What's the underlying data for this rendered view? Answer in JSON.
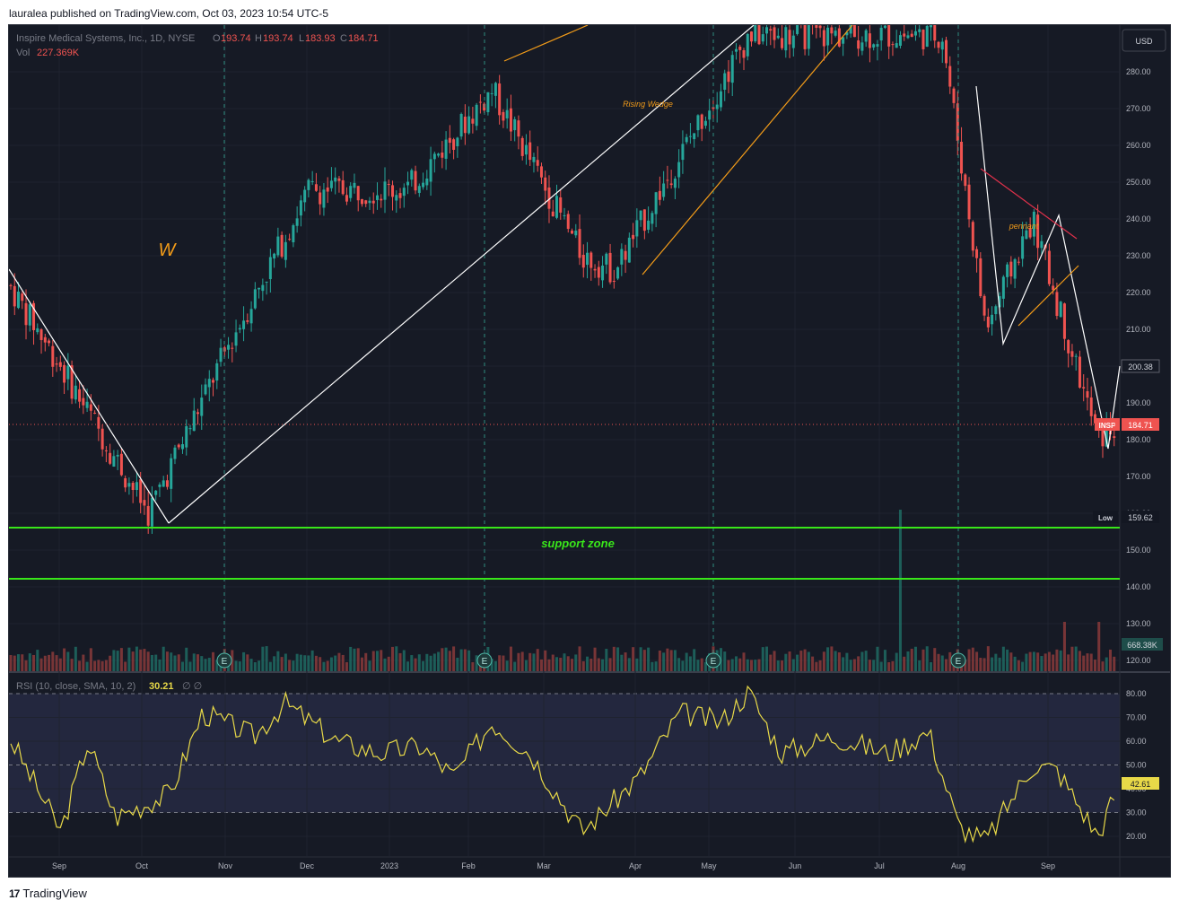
{
  "header": {
    "published": "lauralea published on TradingView.com, Oct 03, 2023 10:54 UTC-5"
  },
  "legend": {
    "symbol": "Inspire Medical Systems, Inc., 1D, NYSE",
    "o_label": "O",
    "o": "193.74",
    "h_label": "H",
    "h": "193.74",
    "l_label": "L",
    "l": "183.93",
    "c_label": "C",
    "c": "184.71",
    "vol_label": "Vol",
    "vol": "227.369K"
  },
  "currency": "USD",
  "rsi_legend": {
    "label": "RSI (10, close, SMA, 10, 2)",
    "value": "30.21",
    "extra": "∅ ∅"
  },
  "annotations": {
    "w": "W",
    "rising_wedge": "Rising Wedge",
    "pennant": "pennant",
    "support_zone": "support zone"
  },
  "price_badges": {
    "last_price": "200.38",
    "symbol_tag": "INSP",
    "close": "184.71",
    "low_label": "Low",
    "low_value": "159.62",
    "volume": "668.38K",
    "rsi_value": "42.61"
  },
  "footer": {
    "brand": "TradingView"
  },
  "colors": {
    "up": "#26a69a",
    "down": "#ef5350",
    "support": "#39e61a",
    "wedge": "#f39c19",
    "rsi_line": "#e8d948",
    "pennant_top": "#e0314b",
    "pattern_lines": "#ffffff"
  },
  "chart_data": {
    "type": "candlestick",
    "title": "Inspire Medical Systems, Inc., 1D, NYSE",
    "price_axis": {
      "ylim": [
        115,
        290
      ],
      "ticks": [
        120,
        130,
        140,
        150,
        160,
        170,
        180,
        190,
        200,
        210,
        220,
        230,
        240,
        250,
        260,
        270,
        280
      ]
    },
    "time_axis_labels": [
      "Sep",
      "Oct",
      "Nov",
      "Dec",
      "2023",
      "Feb",
      "Mar",
      "Apr",
      "May",
      "Jun",
      "Jul",
      "Aug",
      "Sep"
    ],
    "earnings_markers": [
      "Nov",
      "Feb",
      "May",
      "Aug"
    ],
    "support_zone": [
      157.5,
      143.5
    ],
    "approx_close_path": [
      {
        "x": "Aug 22",
        "close": 222
      },
      {
        "x": "Sep 10",
        "close": 200
      },
      {
        "x": "Oct 12",
        "close": 160
      },
      {
        "x": "Nov 10",
        "close": 205
      },
      {
        "x": "Dec 10",
        "close": 248
      },
      {
        "x": "Jan 15",
        "close": 248
      },
      {
        "x": "Feb 15",
        "close": 275
      },
      {
        "x": "Mar 20",
        "close": 230
      },
      {
        "x": "Apr 1",
        "close": 226
      },
      {
        "x": "May 20",
        "close": 290
      },
      {
        "x": "Jul 30",
        "close": 290
      },
      {
        "x": "Aug 15",
        "close": 210
      },
      {
        "x": "Sep 1",
        "close": 240
      },
      {
        "x": "Sep 25",
        "close": 180
      },
      {
        "x": "Oct 3",
        "close": 184.71
      }
    ],
    "rsi": {
      "ticks": [
        20,
        30,
        40,
        50,
        60,
        70,
        80
      ],
      "bands": [
        30,
        50,
        80
      ],
      "last": 42.61,
      "approx_path": [
        {
          "x": "Aug 22",
          "v": 62
        },
        {
          "x": "Sep 10",
          "v": 22
        },
        {
          "x": "Sep 20",
          "v": 60
        },
        {
          "x": "Sep 30",
          "v": 28
        },
        {
          "x": "Oct 20",
          "v": 38
        },
        {
          "x": "Nov 1",
          "v": 72
        },
        {
          "x": "Nov 20",
          "v": 62
        },
        {
          "x": "Dec 1",
          "v": 76
        },
        {
          "x": "Dec 20",
          "v": 60
        },
        {
          "x": "Jan 5",
          "v": 55
        },
        {
          "x": "Jan 20",
          "v": 58
        },
        {
          "x": "Feb 1",
          "v": 45
        },
        {
          "x": "Feb 15",
          "v": 68
        },
        {
          "x": "Mar 1",
          "v": 55
        },
        {
          "x": "Mar 20",
          "v": 22
        },
        {
          "x": "Apr 10",
          "v": 45
        },
        {
          "x": "Apr 25",
          "v": 72
        },
        {
          "x": "May 10",
          "v": 68
        },
        {
          "x": "May 20",
          "v": 81
        },
        {
          "x": "Jun 1",
          "v": 55
        },
        {
          "x": "Jun 20",
          "v": 62
        },
        {
          "x": "Jul 10",
          "v": 55
        },
        {
          "x": "Jul 25",
          "v": 64
        },
        {
          "x": "Aug 5",
          "v": 24
        },
        {
          "x": "Aug 15",
          "v": 18
        },
        {
          "x": "Sep 1",
          "v": 50
        },
        {
          "x": "Sep 10",
          "v": 48
        },
        {
          "x": "Sep 25",
          "v": 20
        },
        {
          "x": "Oct 3",
          "v": 42.61
        }
      ]
    }
  }
}
